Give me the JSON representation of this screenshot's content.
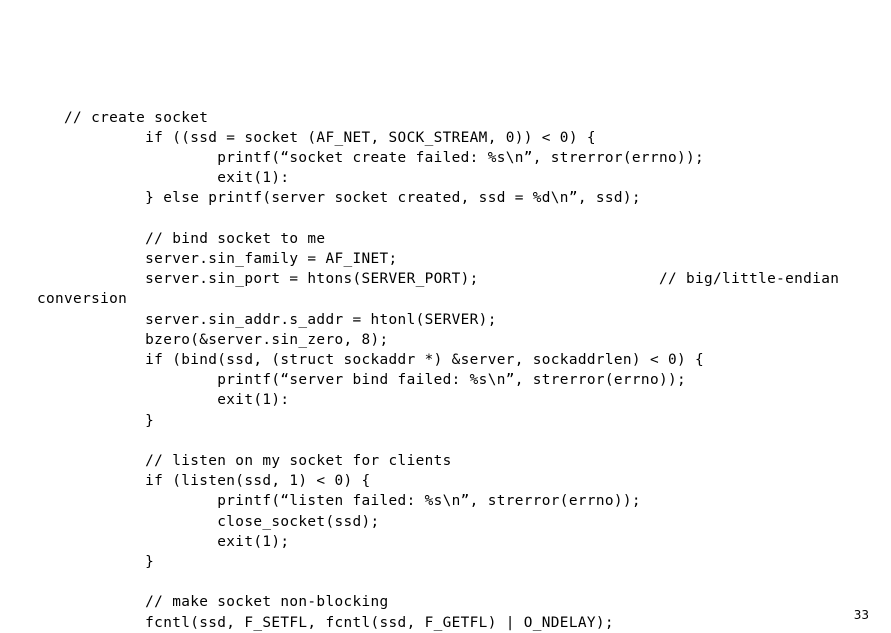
{
  "slide": {
    "page_number": "33",
    "text_color": "#000000",
    "background_color": "#ffffff",
    "code_lines": [
      "   // create socket",
      "            if ((ssd = socket (AF_NET, SOCK_STREAM, 0)) < 0) {",
      "                    printf(“socket create failed: %s\\n”, strerror(errno));",
      "                    exit(1):",
      "            } else printf(server socket created, ssd = %d\\n”, ssd);",
      "",
      "            // bind socket to me",
      "            server.sin_family = AF_INET;",
      "            server.sin_port = htons(SERVER_PORT);                    // big/little-endian conversion",
      "            server.sin_addr.s_addr = htonl(SERVER);",
      "            bzero(&server.sin_zero, 8);",
      "            if (bind(ssd, (struct sockaddr *) &server, sockaddrlen) < 0) {",
      "                    printf(“server bind failed: %s\\n”, strerror(errno));",
      "                    exit(1):",
      "            }",
      "",
      "            // listen on my socket for clients",
      "            if (listen(ssd, 1) < 0) {",
      "                    printf(“listen failed: %s\\n”, strerror(errno));",
      "                    close_socket(ssd);",
      "                    exit(1);",
      "            }",
      "",
      "            // make socket non-blocking",
      "            fcntl(ssd, F_SETFL, fcntl(ssd, F_GETFL) | O_NDELAY);"
    ]
  }
}
